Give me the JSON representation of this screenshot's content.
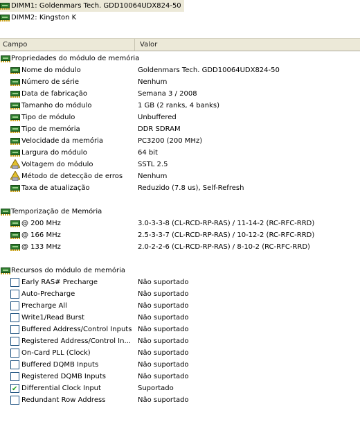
{
  "devices": [
    {
      "label": "DIMM1: Goldenmars Tech. GDD10064UDX824-50",
      "selected": true
    },
    {
      "label": "DIMM2: Kingston K",
      "selected": false
    }
  ],
  "columns": {
    "field": "Campo",
    "value": "Valor"
  },
  "groups": {
    "props": {
      "title": "Propriedades do módulo de memória",
      "rows": [
        {
          "label": "Nome do módulo",
          "value": "Goldenmars Tech. GDD10064UDX824-50",
          "icon": "memory-chip-icon"
        },
        {
          "label": "Número de série",
          "value": "Nenhum",
          "icon": "memory-chip-icon"
        },
        {
          "label": "Data de fabricação",
          "value": "Semana 3 / 2008",
          "icon": "memory-chip-icon"
        },
        {
          "label": "Tamanho do módulo",
          "value": "1 GB (2 ranks, 4 banks)",
          "icon": "memory-chip-icon"
        },
        {
          "label": "Tipo de módulo",
          "value": "Unbuffered",
          "icon": "memory-chip-icon"
        },
        {
          "label": "Tipo de memória",
          "value": "DDR SDRAM",
          "icon": "memory-chip-icon"
        },
        {
          "label": "Velocidade da memória",
          "value": "PC3200 (200 MHz)",
          "icon": "memory-chip-icon"
        },
        {
          "label": "Largura do módulo",
          "value": "64 bit",
          "icon": "memory-chip-icon"
        },
        {
          "label": "Voltagem do módulo",
          "value": "SSTL 2.5",
          "icon": "voltage-icon"
        },
        {
          "label": "Método de detecção de erros",
          "value": "Nenhum",
          "icon": "voltage-icon"
        },
        {
          "label": "Taxa de atualização",
          "value": "Reduzido (7.8 us), Self-Refresh",
          "icon": "memory-chip-icon"
        }
      ]
    },
    "timing": {
      "title": "Temporização de Memória",
      "rows": [
        {
          "label": "@ 200 MHz",
          "value": "3.0-3-3-8  (CL-RCD-RP-RAS) / 11-14-2  (RC-RFC-RRD)"
        },
        {
          "label": "@ 166 MHz",
          "value": "2.5-3-3-7  (CL-RCD-RP-RAS) / 10-12-2  (RC-RFC-RRD)"
        },
        {
          "label": "@ 133 MHz",
          "value": "2.0-2-2-6  (CL-RCD-RP-RAS) / 8-10-2  (RC-RFC-RRD)"
        }
      ]
    },
    "features": {
      "title": "Recursos do módulo de memória",
      "rows": [
        {
          "label": "Early RAS# Precharge",
          "value": "Não suportado",
          "checked": false
        },
        {
          "label": "Auto-Precharge",
          "value": "Não suportado",
          "checked": false
        },
        {
          "label": "Precharge All",
          "value": "Não suportado",
          "checked": false
        },
        {
          "label": "Write1/Read Burst",
          "value": "Não suportado",
          "checked": false
        },
        {
          "label": "Buffered Address/Control Inputs",
          "value": "Não suportado",
          "checked": false
        },
        {
          "label": "Registered Address/Control In...",
          "value": "Não suportado",
          "checked": false
        },
        {
          "label": "On-Card PLL (Clock)",
          "value": "Não suportado",
          "checked": false
        },
        {
          "label": "Buffered DQMB Inputs",
          "value": "Não suportado",
          "checked": false
        },
        {
          "label": "Registered DQMB Inputs",
          "value": "Não suportado",
          "checked": false
        },
        {
          "label": "Differential Clock Input",
          "value": "Suportado",
          "checked": true
        },
        {
          "label": "Redundant Row Address",
          "value": "Não suportado",
          "checked": false
        }
      ]
    }
  }
}
